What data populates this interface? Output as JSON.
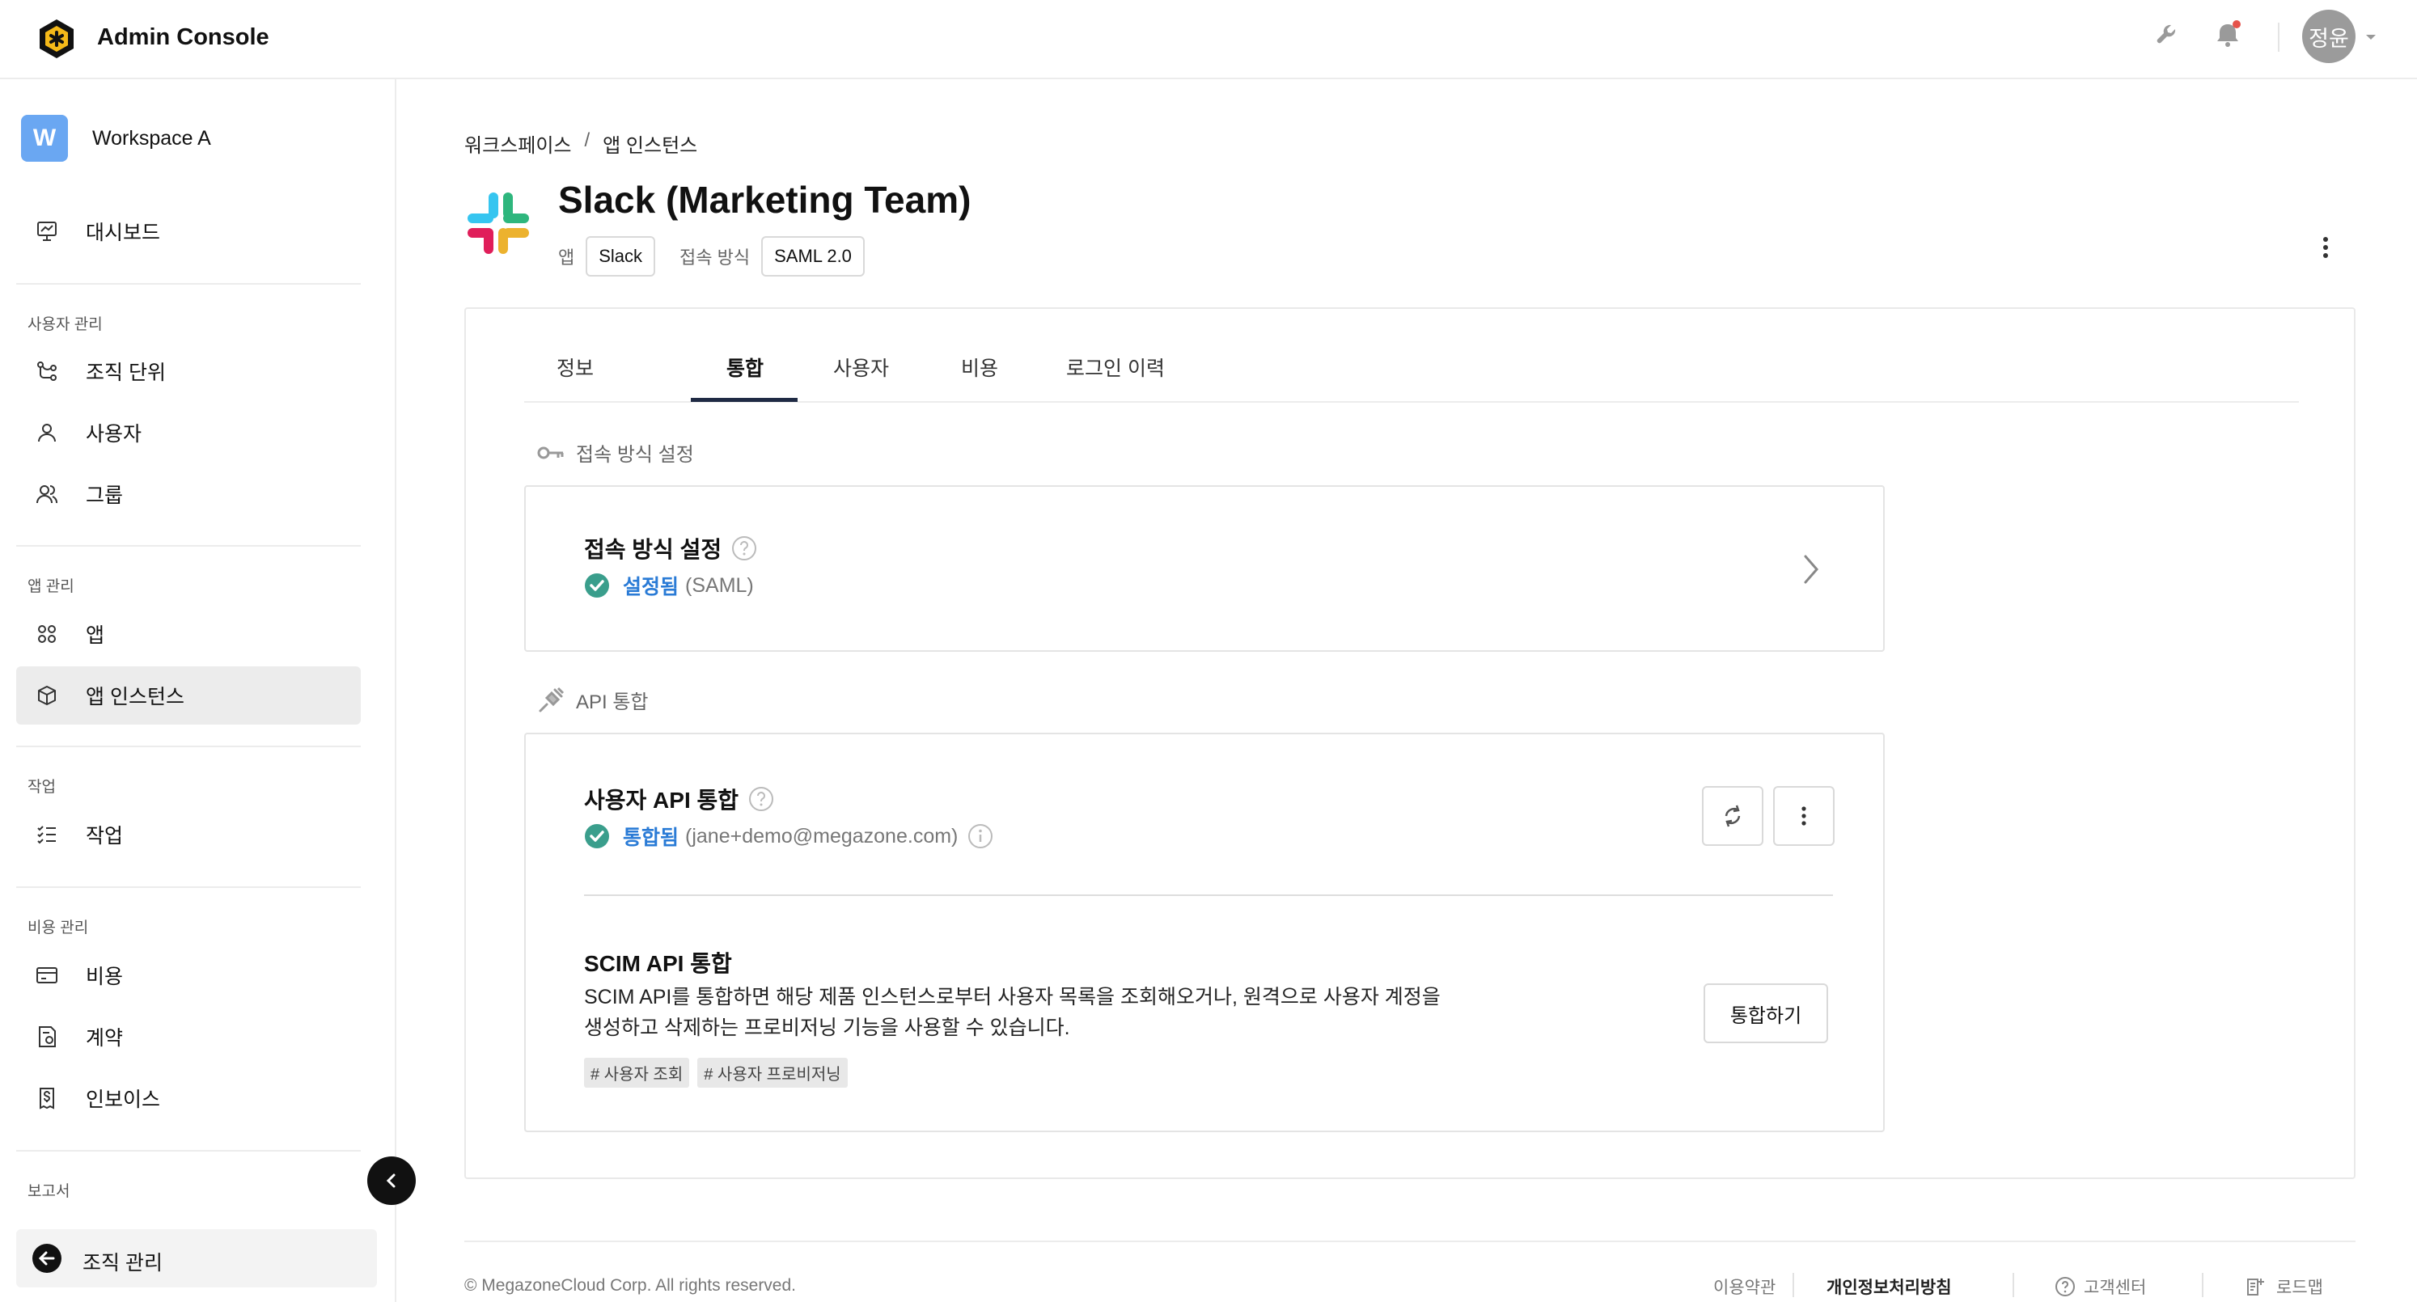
{
  "header": {
    "app_title": "Admin Console",
    "avatar_text": "정윤",
    "colors": {
      "notification_dot": "#e5534b",
      "avatar_bg": "#9b9b9b"
    }
  },
  "sidebar": {
    "workspace": {
      "badge": "W",
      "name": "Workspace A",
      "badge_color": "#6aa7f2"
    },
    "dashboard": "대시보드",
    "sections": [
      {
        "title": "사용자 관리",
        "items": [
          "조직 단위",
          "사용자",
          "그룹"
        ]
      },
      {
        "title": "앱 관리",
        "items": [
          "앱",
          "앱 인스턴스"
        ]
      },
      {
        "title": "작업",
        "items": [
          "작업"
        ]
      },
      {
        "title": "비용 관리",
        "items": [
          "비용",
          "계약",
          "인보이스"
        ]
      },
      {
        "title": "보고서",
        "items": []
      }
    ],
    "active_item": "앱 인스턴스",
    "org_manage": "조직 관리"
  },
  "breadcrumb": {
    "items": [
      "워크스페이스",
      "앱 인스턴스"
    ],
    "separator": "/"
  },
  "page": {
    "title": "Slack (Marketing Team)",
    "app_label": "앱",
    "app_value": "Slack",
    "method_label": "접속 방식",
    "method_value": "SAML 2.0"
  },
  "tabs": [
    {
      "label": "정보",
      "active": false
    },
    {
      "label": "통합",
      "active": true
    },
    {
      "label": "사용자",
      "active": false
    },
    {
      "label": "비용",
      "active": false
    },
    {
      "label": "로그인 이력",
      "active": false
    }
  ],
  "access": {
    "section_title": "접속 방식 설정",
    "item_title": "접속 방식 설정",
    "status": "설정됨",
    "detail": "(SAML)"
  },
  "api": {
    "section_title": "API 통합",
    "user_api": {
      "title": "사용자 API 통합",
      "status": "통합됨",
      "detail": "(jane+demo@megazone.com)"
    },
    "scim": {
      "title": "SCIM API 통합",
      "desc_line1": "SCIM API를 통합하면 해당 제품 인스턴스로부터 사용자 목록을 조회해오거나, 원격으로 사용자 계정을",
      "desc_line2": "생성하고 삭제하는 프로비저닝 기능을 사용할 수 있습니다.",
      "tags": [
        "# 사용자 조회",
        "# 사용자 프로비저닝"
      ],
      "button": "통합하기"
    }
  },
  "footer": {
    "copyright": "© MegazoneCloud Corp. All rights reserved.",
    "links": [
      "이용약관",
      "개인정보처리방침",
      "고객센터",
      "로드맵"
    ]
  }
}
